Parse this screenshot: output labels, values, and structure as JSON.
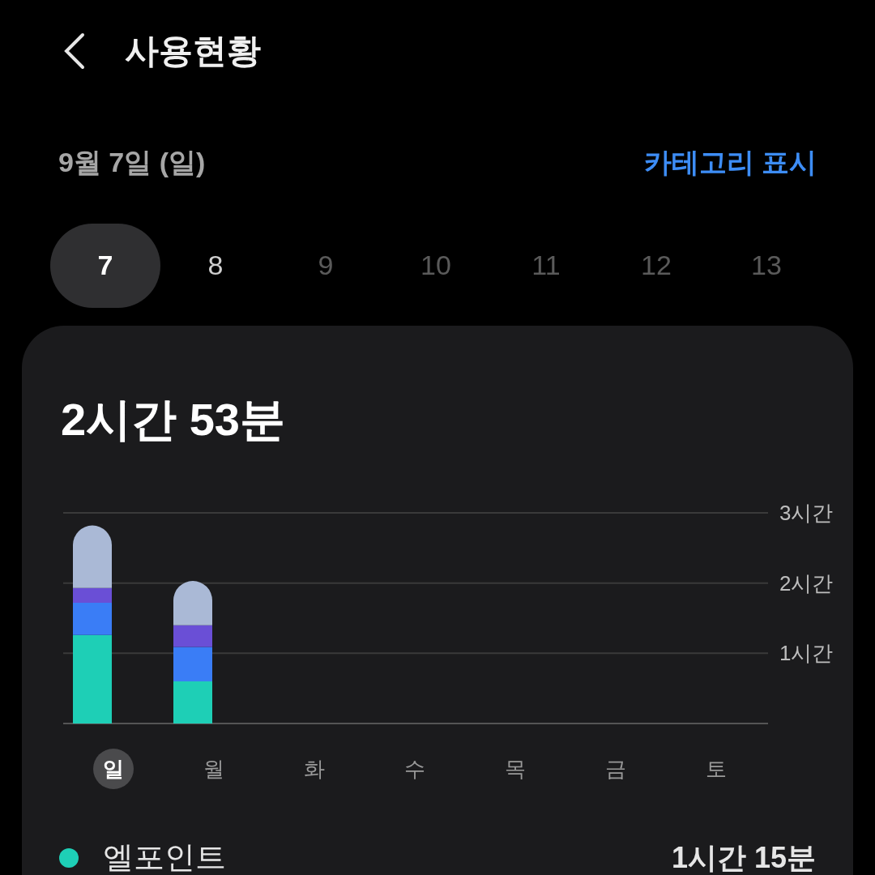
{
  "header": {
    "title": "사용현황"
  },
  "date_label": "9월 7일 (일)",
  "category_link": "카테고리 표시",
  "days": [
    {
      "label": "7",
      "selected": true,
      "disabled": false
    },
    {
      "label": "8",
      "selected": false,
      "disabled": false
    },
    {
      "label": "9",
      "selected": false,
      "disabled": true
    },
    {
      "label": "10",
      "selected": false,
      "disabled": true
    },
    {
      "label": "11",
      "selected": false,
      "disabled": true
    },
    {
      "label": "12",
      "selected": false,
      "disabled": true
    },
    {
      "label": "13",
      "selected": false,
      "disabled": true
    }
  ],
  "card": {
    "total": "2시간 53분",
    "chart_data": {
      "type": "bar",
      "stacked": true,
      "ylim": [
        0,
        3
      ],
      "yticks": [
        {
          "value": 1,
          "label": "1시간"
        },
        {
          "value": 2,
          "label": "2시간"
        },
        {
          "value": 3,
          "label": "3시간"
        }
      ],
      "series": [
        {
          "color": "#1ecfb6",
          "values": [
            1.26,
            0.6,
            null,
            null,
            null,
            null,
            null
          ]
        },
        {
          "color": "#3a7df6",
          "values": [
            0.46,
            0.49,
            null,
            null,
            null,
            null,
            null
          ]
        },
        {
          "color": "#6a4fd6",
          "values": [
            0.21,
            0.31,
            null,
            null,
            null,
            null,
            null
          ]
        },
        {
          "color": "#aab9d6",
          "values": [
            0.89,
            0.63,
            null,
            null,
            null,
            null,
            null
          ]
        }
      ]
    },
    "weekdays": [
      {
        "label": "일",
        "selected": true
      },
      {
        "label": "월",
        "selected": false
      },
      {
        "label": "화",
        "selected": false
      },
      {
        "label": "수",
        "selected": false
      },
      {
        "label": "목",
        "selected": false
      },
      {
        "label": "금",
        "selected": false
      },
      {
        "label": "토",
        "selected": false
      }
    ],
    "apps": [
      {
        "name": "엘포인트",
        "time": "1시간 15분",
        "color": "#1ecfb6"
      }
    ]
  }
}
